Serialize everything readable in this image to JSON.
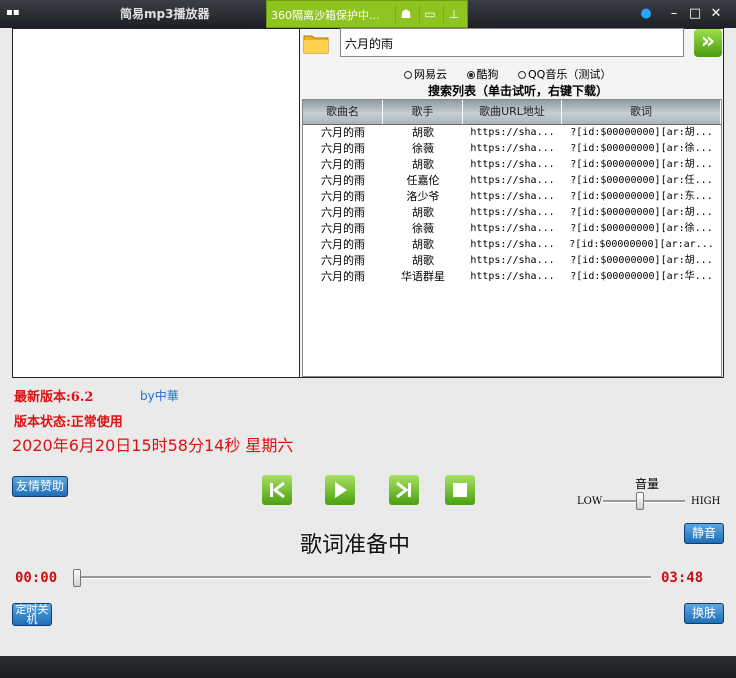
{
  "window": {
    "title": "简易mp3播放器",
    "sandbox_label": "360隔离沙箱保护中...",
    "colors": {
      "accent_green": "#8fc31f",
      "status_red": "#dd1111",
      "link_blue": "#2070d0"
    }
  },
  "search": {
    "value": "六月的雨"
  },
  "sources": [
    {
      "label": "网易云",
      "selected": false
    },
    {
      "label": "酷狗",
      "selected": true
    },
    {
      "label": "QQ音乐（测试）",
      "selected": false
    }
  ],
  "list_title": "搜索列表（单击试听，右键下载）",
  "table": {
    "columns": [
      "歌曲名",
      "歌手",
      "歌曲URL地址",
      "歌词"
    ],
    "rows": [
      [
        "六月的雨",
        "胡歌",
        "https://sha...",
        "?[id:$00000000][ar:胡..."
      ],
      [
        "六月的雨",
        "徐薇",
        "https://sha...",
        "?[id:$00000000][ar:徐..."
      ],
      [
        "六月的雨",
        "胡歌",
        "https://sha...",
        "?[id:$00000000][ar:胡..."
      ],
      [
        "六月的雨",
        "任嘉伦",
        "https://sha...",
        "?[id:$00000000][ar:任..."
      ],
      [
        "六月的雨",
        "洛少爷",
        "https://sha...",
        "?[id:$00000000][ar:东..."
      ],
      [
        "六月的雨",
        "胡歌",
        "https://sha...",
        "?[id:$00000000][ar:胡..."
      ],
      [
        "六月的雨",
        "徐薇",
        "https://sha...",
        "?[id:$00000000][ar:徐..."
      ],
      [
        "六月的雨",
        "胡歌",
        "https://sha...",
        "?[id:$00000000][ar:ar..."
      ],
      [
        "六月的雨",
        "胡歌",
        "https://sha...",
        "?[id:$00000000][ar:胡..."
      ],
      [
        "六月的雨",
        "华语群星",
        "https://sha...",
        "?[id:$00000000][ar:华..."
      ]
    ]
  },
  "info": {
    "version": "最新版本:6.2",
    "by": "by中華",
    "status": "版本状态:正常使用",
    "datetime": "2020年6月20日15时58分14秒  星期六"
  },
  "buttons": {
    "donate": "友情赞助",
    "mute": "静音",
    "timer": "定时关机",
    "skin": "换肤"
  },
  "volume": {
    "label": "音量",
    "low": "LOW",
    "high": "HIGH",
    "level": 0.45
  },
  "lyric_status": "歌词准备中",
  "playback": {
    "current": "00:00",
    "total": "03:48",
    "progress": 0.0
  },
  "icons": {
    "prev": "skip-back-icon",
    "play": "play-icon",
    "next": "skip-forward-icon",
    "stop": "stop-icon",
    "go": "double-chevron-right-icon",
    "folder": "folder-icon"
  }
}
